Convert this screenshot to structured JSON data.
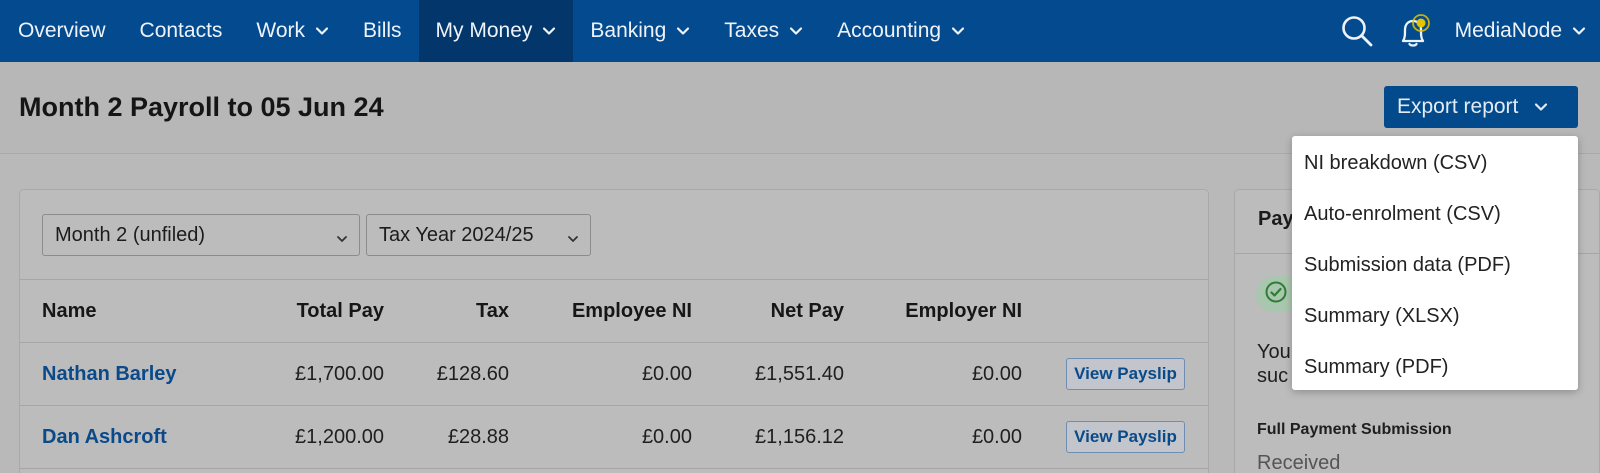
{
  "nav": {
    "items": [
      {
        "label": "Overview",
        "dropdown": false
      },
      {
        "label": "Contacts",
        "dropdown": false
      },
      {
        "label": "Work",
        "dropdown": true
      },
      {
        "label": "Bills",
        "dropdown": false
      },
      {
        "label": "My Money",
        "dropdown": true,
        "active": true
      },
      {
        "label": "Banking",
        "dropdown": true
      },
      {
        "label": "Taxes",
        "dropdown": true
      },
      {
        "label": "Accounting",
        "dropdown": true
      }
    ],
    "org_name": "MediaNode",
    "icons": [
      "search-icon",
      "notification-bell-icon"
    ]
  },
  "header": {
    "title": "Month 2 Payroll to 05 Jun 24",
    "export_label": "Export report"
  },
  "export_menu": {
    "items": [
      "NI breakdown (CSV)",
      "Auto-enrolment (CSV)",
      "Submission data (PDF)",
      "Summary (XLSX)",
      "Summary (PDF)"
    ]
  },
  "filters": {
    "period": "Month 2 (unfiled)",
    "tax_year": "Tax Year 2024/25"
  },
  "table": {
    "columns": [
      "Name",
      "Total Pay",
      "Tax",
      "Employee NI",
      "Net Pay",
      "Employer NI"
    ],
    "action_label": "View Payslip",
    "rows": [
      {
        "name": "Nathan Barley",
        "total_pay": "£1,700.00",
        "tax": "£128.60",
        "employee_ni": "£0.00",
        "net_pay": "£1,551.40",
        "employer_ni": "£0.00"
      },
      {
        "name": "Dan Ashcroft",
        "total_pay": "£1,200.00",
        "tax": "£28.88",
        "employee_ni": "£0.00",
        "net_pay": "£1,156.12",
        "employer_ni": "£0.00"
      }
    ]
  },
  "side_panel": {
    "title_partial": "Pay",
    "message_line1": "You",
    "message_line2": "suc",
    "fps_label": "Full Payment Submission",
    "fps_status": "Received"
  },
  "colors": {
    "nav_bg": "#044a8f",
    "nav_active": "#03366a",
    "button_bg": "#034a8c",
    "link": "#0a4a8a",
    "success": "#2e7d32",
    "notification_dot": "#e5c300"
  }
}
